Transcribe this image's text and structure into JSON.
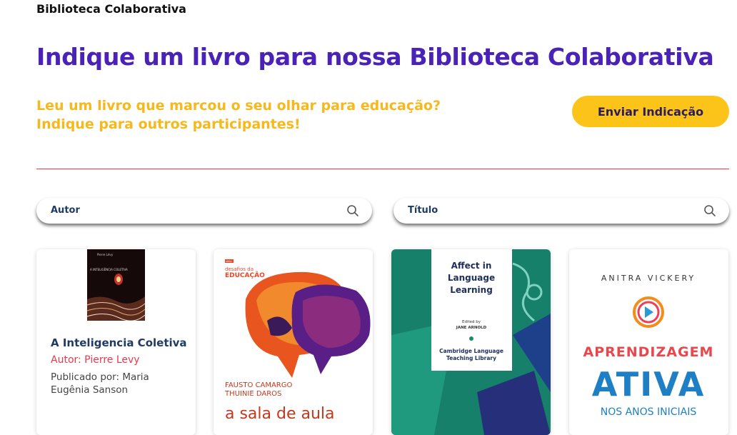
{
  "header": {
    "breadcrumb": "Biblioteca Colaborativa",
    "title": "Indique um livro para nossa Biblioteca Colaborativa",
    "subtitle_line1": "Leu um livro que marcou o seu olhar para educação?",
    "subtitle_line2": "Indique para outros participantes!",
    "cta_label": "Enviar Indicação"
  },
  "filters": {
    "author_label": "Autor",
    "title_label": "Título"
  },
  "books": [
    {
      "title": "A Inteligencia Coletiva",
      "author": "Autor: Pierre Levy",
      "published_by": "Publicado por: Maria Eugênia Sanson",
      "cover_text": [
        "Pierre Lévy",
        "A INTELIGÊNCIA COLETIVA"
      ]
    },
    {
      "cover_text": [
        "série",
        "desafios da",
        "EDUCAÇÃO",
        "FAUSTO CAMARGO",
        "THUINIE DAROS",
        "a sala de aula"
      ]
    },
    {
      "cover_text": [
        "Affect in",
        "Language",
        "Learning",
        "Edited by",
        "JANE ARNOLD",
        "Cambridge Language",
        "Teaching Library"
      ]
    },
    {
      "cover_text": [
        "ANITRA VICKERY",
        "APRENDIZAGEM",
        "ATIVA",
        "NOS ANOS INICIAIS"
      ]
    }
  ],
  "colors": {
    "title": "#4a22b8",
    "accent_yellow": "#fcc318",
    "divider": "#e63b4a",
    "author": "#e63b4a"
  }
}
